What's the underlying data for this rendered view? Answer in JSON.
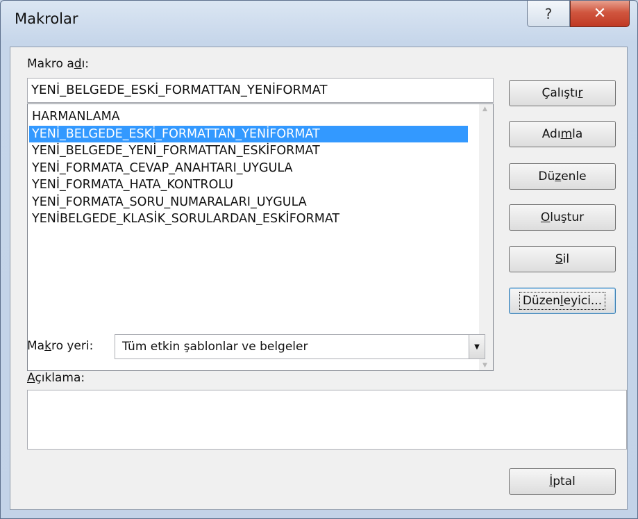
{
  "window": {
    "title": "Makrolar",
    "help_glyph": "?",
    "close_glyph": "✕"
  },
  "macro_name": {
    "label_pre": "Makro a",
    "label_acc": "d",
    "label_post": "ı:",
    "value": "YENİ_BELGEDE_ESKİ_FORMATTAN_YENİFORMAT"
  },
  "macro_list": {
    "items": [
      "HARMANLAMA",
      "YENİ_BELGEDE_ESKİ_FORMATTAN_YENİFORMAT",
      "YENİ_BELGEDE_YENİ_FORMATTAN_ESKİFORMAT",
      "YENİ_FORMATA_CEVAP_ANAHTARI_UYGULA",
      "YENİ_FORMATA_HATA_KONTROLU",
      "YENİ_FORMATA_SORU_NUMARALARI_UYGULA",
      "YENİBELGEDE_KLASİK_SORULARDAN_ESKİFORMAT"
    ],
    "selected_index": 1
  },
  "buttons": {
    "run": {
      "pre": "Çalıştı",
      "acc": "r",
      "post": ""
    },
    "step": {
      "pre": "Adı",
      "acc": "m",
      "post": "la"
    },
    "edit": {
      "pre": "Dü",
      "acc": "z",
      "post": "enle"
    },
    "create": {
      "pre": "",
      "acc": "O",
      "post": "luştur"
    },
    "delete": {
      "pre": "",
      "acc": "S",
      "post": "il"
    },
    "organizer": {
      "pre": "Düzen",
      "acc": "l",
      "post": "eyici..."
    },
    "cancel": {
      "pre": "",
      "acc": "İ",
      "post": "ptal"
    }
  },
  "macros_in": {
    "label_pre": "Ma",
    "label_acc": "k",
    "label_post": "ro yeri:",
    "selected": "Tüm etkin şablonlar ve belgeler"
  },
  "description": {
    "label_pre": "",
    "label_acc": "A",
    "label_post": "çıklama:",
    "value": ""
  },
  "colors": {
    "selection": "#3399ff",
    "close_button": "#c8462f"
  }
}
